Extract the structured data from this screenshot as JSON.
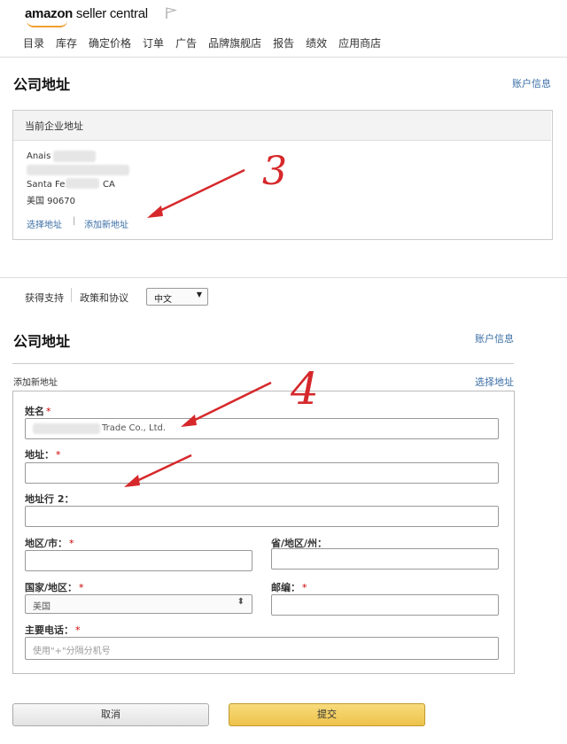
{
  "header": {
    "logo_bold": "amazon",
    "logo_rest": " seller central",
    "nav": [
      "目录",
      "库存",
      "确定价格",
      "订单",
      "广告",
      "品牌旗舰店",
      "报告",
      "绩效",
      "应用商店"
    ]
  },
  "section1": {
    "title": "公司地址",
    "account_link": "账户信息",
    "box_header": "当前企业地址",
    "address_lines": [
      "Anais",
      "Santa Fe",
      "CA",
      "美国 90670"
    ],
    "link_choose": "选择地址",
    "link_divider": "|",
    "link_add": "添加新地址"
  },
  "footer_links": {
    "support": "获得支持",
    "policy": "政策和协议",
    "language": "中文"
  },
  "section2": {
    "title": "公司地址",
    "account_link": "账户信息",
    "subheader": "添加新地址",
    "choose_link": "选择地址",
    "fields": {
      "name_label": "姓名",
      "name_value": "Trade Co., Ltd.",
      "address_label": "地址：",
      "address2_label": "地址行 2：",
      "city_label": "地区/市：",
      "state_label": "省/地区/州：",
      "country_label": "国家/地区：",
      "country_value": "美国",
      "zip_label": "邮编：",
      "phone_label": "主要电话：",
      "phone_placeholder": "使用\"+\"分隔分机号"
    },
    "cancel_label": "取消",
    "submit_label": "提交"
  },
  "annotations": {
    "note3": "3",
    "note4": "4",
    "color": "#d6282b"
  }
}
